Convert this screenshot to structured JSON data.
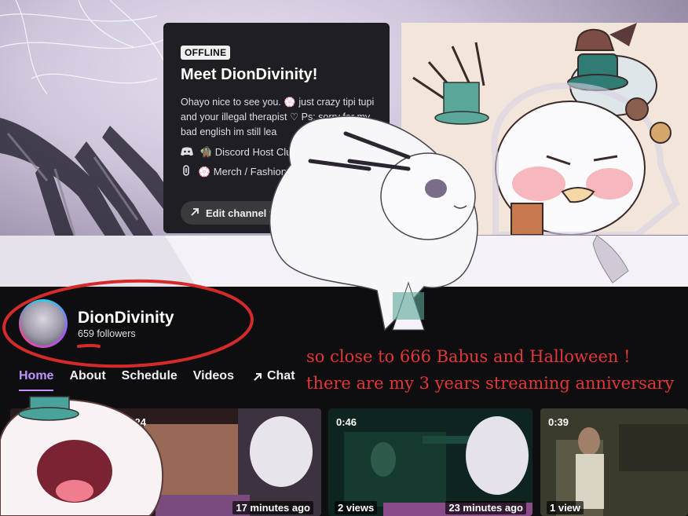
{
  "trailer": {
    "badge": "OFFLINE",
    "title": "Meet DionDivinity!",
    "description": "Ohayo nice to see you. 💮 just crazy tipi tupi and your illegal therapist ♡ Ps: sorry for my bad english im still lea",
    "links": [
      {
        "icon": "discord-icon",
        "label": "🧌 Discord Host Clu"
      },
      {
        "icon": "link-icon",
        "label": "💮 Merch / Fashion S"
      }
    ],
    "edit_button": "Edit channel traile"
  },
  "channel": {
    "name": "DionDivinity",
    "followers": "659 followers"
  },
  "nav": {
    "tabs": [
      {
        "label": "Home",
        "active": true
      },
      {
        "label": "About",
        "active": false
      },
      {
        "label": "Schedule",
        "active": false
      },
      {
        "label": "Videos",
        "active": false
      },
      {
        "label": "Chat",
        "active": false
      }
    ]
  },
  "annotation": {
    "line1": "so close to 666 Babus and Halloween !",
    "line2": "there are my 3 years streaming anniversary"
  },
  "videos": [
    {
      "duration": "0:24",
      "time": "17 minutes ago",
      "views": ""
    },
    {
      "duration": "0:46",
      "time": "23 minutes ago",
      "views": "2 views"
    },
    {
      "duration": "0:39",
      "time": "",
      "views": "1 view"
    }
  ],
  "colors": {
    "accent": "#bf94ff",
    "annotation": "#e23737",
    "background": "#0e0e10"
  }
}
